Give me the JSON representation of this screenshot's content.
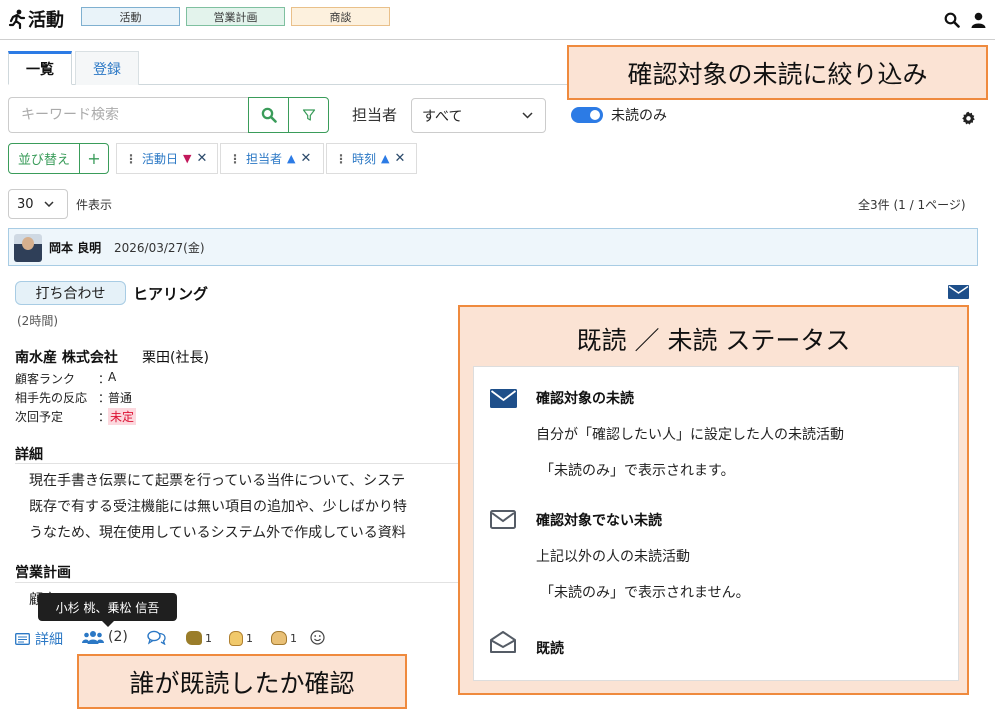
{
  "header": {
    "app_title": "活動",
    "nav_tabs": [
      {
        "label": "活動",
        "bg": "#e9f3f9",
        "border": "#7fb0d0"
      },
      {
        "label": "営業計画",
        "bg": "#e3f3ec",
        "border": "#7fc0a0"
      },
      {
        "label": "商談",
        "bg": "#fdf1de",
        "border": "#e9c08a"
      }
    ]
  },
  "tabs": [
    {
      "label": "一覧"
    },
    {
      "label": "登録"
    }
  ],
  "filters": {
    "keyword_placeholder": "キーワード検索",
    "owner_label": "担当者",
    "owner_value": "すべて",
    "unread_only_label": "未読のみ"
  },
  "sort": {
    "label": "並び替え",
    "add": "+",
    "chips": [
      {
        "label": "活動日",
        "dir": "▼",
        "dir_color": "#c2185b"
      },
      {
        "label": "担当者",
        "dir": "▲",
        "dir_color": "#2c7be5"
      },
      {
        "label": "時刻",
        "dir": "▲",
        "dir_color": "#2c7be5"
      }
    ]
  },
  "listing": {
    "per_page": "30",
    "per_page_suffix": "件表示",
    "total": "全3件 (1 / 1ページ)"
  },
  "activity": {
    "user_name": "岡本 良明",
    "date": "2026/03/27(金)",
    "type": "打ち合わせ",
    "title": "ヒアリング",
    "duration": "(2時間)",
    "company": "南水産 株式会社",
    "contact": "栗田(社長)",
    "fields": [
      {
        "label": "顧客ランク",
        "sep": "：",
        "value": "A"
      },
      {
        "label": "相手先の反応",
        "sep": "：",
        "value": "普通"
      },
      {
        "label": "次回予定",
        "sep": "：",
        "value": "未定"
      }
    ],
    "details_heading": "詳細",
    "details_lines": [
      "現在手書き伝票にて起票を行っている当件について、システ",
      "既存で有する受注機能には無い項目の追加や、少しばかり特",
      "うなため、現在使用しているシステム外で作成している資料"
    ],
    "plan_heading": "営業計画",
    "plan_partial": "顧客",
    "footer": {
      "details_link": "詳細",
      "readers_count": "(2)",
      "reactions": [
        "1",
        "1",
        "1"
      ]
    },
    "tooltip": "小杉 桃、乗松 信吾"
  },
  "callouts": {
    "filter_note": "確認対象の未読に絞り込み",
    "status_title": "既読 ／ 未読 ステータス",
    "reader_note": "誰が既読したか確認"
  },
  "legend": [
    {
      "title": "確認対象の未読",
      "lines": [
        "自分が「確認したい人」に設定した人の未読活動",
        "「未読のみ」で表示されます。"
      ]
    },
    {
      "title": "確認対象でない未読",
      "lines": [
        "上記以外の人の未読活動",
        "「未読のみ」で表示されません。"
      ]
    },
    {
      "title": "既読",
      "lines": []
    }
  ],
  "colors": {
    "accent_blue": "#2c7be5",
    "accent_green": "#3a9c5a",
    "callout_orange": "#ef8a3e",
    "callout_fill": "#fbe3d4",
    "envelope_navy": "#1e4f8a"
  }
}
